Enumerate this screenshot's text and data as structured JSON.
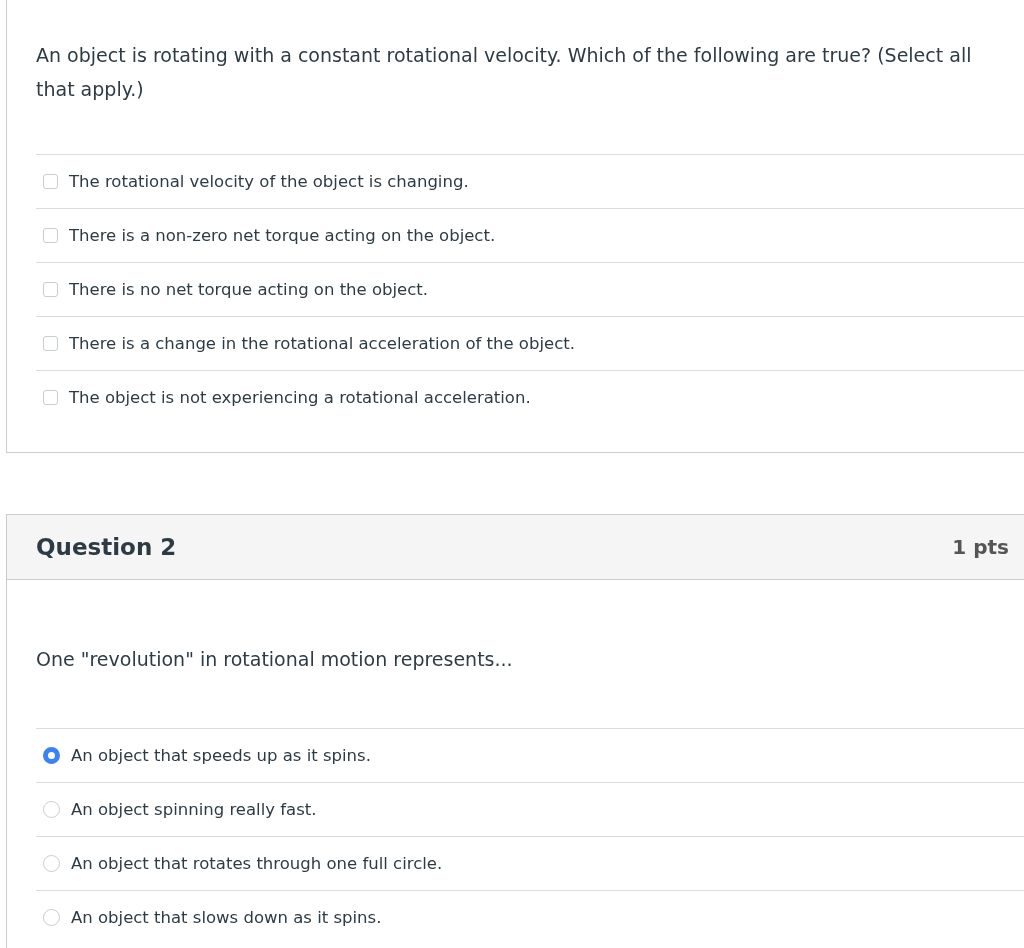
{
  "questions": [
    {
      "kind": "multiple",
      "text": "An object is rotating with a constant rotational velocity.  Which of the following are true? (Select all that apply.)",
      "answers": [
        {
          "label": "The rotational velocity of the object is changing.",
          "selected": false
        },
        {
          "label": "There is a non-zero net torque acting on the object.",
          "selected": false
        },
        {
          "label": "There is no net torque acting on the object.",
          "selected": false
        },
        {
          "label": "There is a change in the rotational acceleration of the object.",
          "selected": false
        },
        {
          "label": "The object is not experiencing a rotational acceleration.",
          "selected": false
        }
      ]
    },
    {
      "kind": "single",
      "title": "Question 2",
      "points": "1 pts",
      "text": "One \"revolution\" in rotational motion represents...",
      "answers": [
        {
          "label": "An object that speeds up as it spins.",
          "selected": true
        },
        {
          "label": "An object spinning really fast.",
          "selected": false
        },
        {
          "label": "An object that rotates through one full circle.",
          "selected": false
        },
        {
          "label": "An object that slows down as it spins.",
          "selected": false
        }
      ]
    }
  ]
}
